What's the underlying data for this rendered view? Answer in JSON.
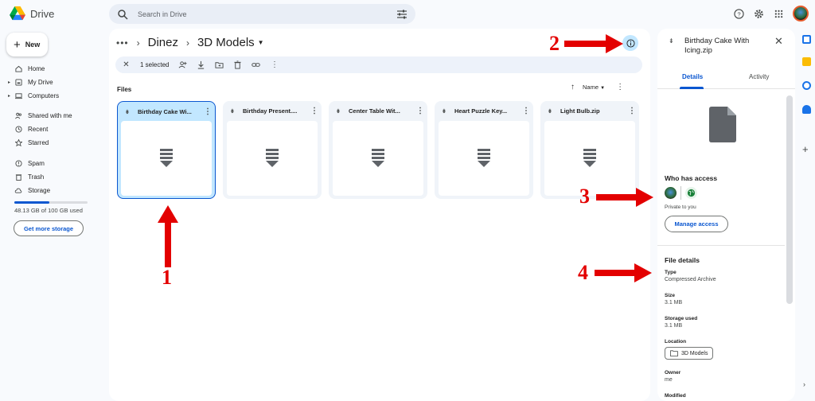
{
  "app": {
    "name": "Drive"
  },
  "search": {
    "placeholder": "Search in Drive"
  },
  "sidebar": {
    "new_label": "New",
    "items": [
      {
        "label": "Home",
        "icon": "home-icon"
      },
      {
        "label": "My Drive",
        "icon": "my-drive-icon"
      },
      {
        "label": "Computers",
        "icon": "computers-icon"
      },
      {
        "label": "Shared with me",
        "icon": "shared-icon"
      },
      {
        "label": "Recent",
        "icon": "clock-icon"
      },
      {
        "label": "Starred",
        "icon": "star-icon"
      },
      {
        "label": "Spam",
        "icon": "spam-icon"
      },
      {
        "label": "Trash",
        "icon": "trash-icon"
      },
      {
        "label": "Storage",
        "icon": "cloud-icon"
      }
    ],
    "storage_text": "48.13 GB of 100 GB used",
    "storage_fraction": 0.4813,
    "get_storage_label": "Get more storage"
  },
  "breadcrumb": {
    "parent": "Dinez",
    "current": "3D Models"
  },
  "selection": {
    "count_label": "1 selected"
  },
  "files": {
    "section_label": "Files",
    "sort_label": "Name",
    "items": [
      {
        "name": "Birthday Cake Wi...",
        "selected": true
      },
      {
        "name": "Birthday Present....",
        "selected": false
      },
      {
        "name": "Center Table Wit...",
        "selected": false
      },
      {
        "name": "Heart Puzzle Key...",
        "selected": false
      },
      {
        "name": "Light Bulb.zip",
        "selected": false
      }
    ]
  },
  "details": {
    "title": "Birthday Cake With Icing.zip",
    "tabs": [
      "Details",
      "Activity"
    ],
    "who_has_access": "Who has access",
    "private_text": "Private to you",
    "manage_access": "Manage access",
    "file_details_title": "File details",
    "type_label": "Type",
    "type_value": "Compressed Archive",
    "size_label": "Size",
    "size_value": "3.1 MB",
    "storage_used_label": "Storage used",
    "storage_used_value": "3.1 MB",
    "location_label": "Location",
    "location_value": "3D Models",
    "owner_label": "Owner",
    "owner_value": "me",
    "modified_label": "Modified"
  },
  "annotations": [
    "1",
    "2",
    "3",
    "4"
  ],
  "colors": {
    "accent": "#0b57d0",
    "selected_bg": "#c2e7ff",
    "annotation_red": "#e30000"
  }
}
